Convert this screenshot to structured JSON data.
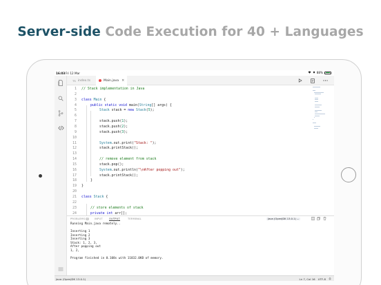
{
  "headline": {
    "strong": "Server-side",
    "soft": "Code Execution for 40 + Languages"
  },
  "status_bar": {
    "time": "16:03",
    "date": "Fri 12 Mar",
    "battery": "88%",
    "battery_level": 0.88
  },
  "tabs": [
    {
      "label": "index.ts"
    },
    {
      "label": "Main.java",
      "active": true
    }
  ],
  "code_lines": [
    {
      "n": "1",
      "indent": 0,
      "parts": [
        [
          "cmt",
          "// Stack implementation in Java"
        ]
      ]
    },
    {
      "n": "2",
      "indent": 0,
      "parts": []
    },
    {
      "n": "3",
      "indent": 0,
      "parts": [
        [
          "kw",
          "class "
        ],
        [
          "ty",
          "Main"
        ],
        [
          "plain",
          " {"
        ]
      ]
    },
    {
      "n": "4",
      "indent": 1,
      "parts": [
        [
          "kw",
          "public static void "
        ],
        [
          "plain",
          "main("
        ],
        [
          "ty",
          "String"
        ],
        [
          "plain",
          "[] args) {"
        ]
      ]
    },
    {
      "n": "5",
      "indent": 2,
      "parts": [
        [
          "ty",
          "Stack"
        ],
        [
          "plain",
          " stack = "
        ],
        [
          "kw",
          "new "
        ],
        [
          "ty",
          "Stack"
        ],
        [
          "plain",
          "("
        ],
        [
          "num",
          "5"
        ],
        [
          "plain",
          ");"
        ]
      ]
    },
    {
      "n": "6",
      "indent": 0,
      "parts": []
    },
    {
      "n": "7",
      "indent": 2,
      "parts": [
        [
          "plain",
          "stack.push("
        ],
        [
          "num",
          "1"
        ],
        [
          "plain",
          ");"
        ]
      ]
    },
    {
      "n": "8",
      "indent": 2,
      "parts": [
        [
          "plain",
          "stack.push("
        ],
        [
          "num",
          "2"
        ],
        [
          "plain",
          ");"
        ]
      ]
    },
    {
      "n": "9",
      "indent": 2,
      "parts": [
        [
          "plain",
          "stack.push("
        ],
        [
          "num",
          "3"
        ],
        [
          "plain",
          ");"
        ]
      ]
    },
    {
      "n": "10",
      "indent": 0,
      "parts": []
    },
    {
      "n": "11",
      "indent": 2,
      "parts": [
        [
          "ty",
          "System"
        ],
        [
          "plain",
          ".out.print("
        ],
        [
          "str",
          "\"Stack: \""
        ],
        [
          "plain",
          ");"
        ]
      ]
    },
    {
      "n": "12",
      "indent": 2,
      "parts": [
        [
          "plain",
          "stack.printStack();"
        ]
      ]
    },
    {
      "n": "13",
      "indent": 0,
      "parts": []
    },
    {
      "n": "14",
      "indent": 2,
      "parts": [
        [
          "cmt",
          "// remove element from stack"
        ]
      ]
    },
    {
      "n": "15",
      "indent": 2,
      "parts": [
        [
          "plain",
          "stack.pop();"
        ]
      ]
    },
    {
      "n": "16",
      "indent": 2,
      "parts": [
        [
          "ty",
          "System"
        ],
        [
          "plain",
          ".out.println("
        ],
        [
          "str",
          "\"\\nAfter popping out\""
        ],
        [
          "plain",
          ");"
        ]
      ]
    },
    {
      "n": "17",
      "indent": 2,
      "parts": [
        [
          "plain",
          "stack.printStack();"
        ]
      ]
    },
    {
      "n": "18",
      "indent": 1,
      "parts": [
        [
          "plain",
          "}"
        ]
      ]
    },
    {
      "n": "19",
      "indent": 0,
      "parts": [
        [
          "plain",
          "}"
        ]
      ]
    },
    {
      "n": "20",
      "indent": 0,
      "parts": []
    },
    {
      "n": "21",
      "indent": 0,
      "parts": [
        [
          "kw",
          "class "
        ],
        [
          "ty",
          "Stack"
        ],
        [
          "plain",
          " {"
        ]
      ]
    },
    {
      "n": "22",
      "indent": 0,
      "parts": []
    },
    {
      "n": "23",
      "indent": 1,
      "parts": [
        [
          "cmt",
          "// store elements of stack"
        ]
      ]
    },
    {
      "n": "24",
      "indent": 1,
      "parts": [
        [
          "kw",
          "private int "
        ],
        [
          "plain",
          "arr[];"
        ]
      ]
    }
  ],
  "panel": {
    "tabs": [
      {
        "label": "PROBLEMS",
        "count": "0"
      },
      {
        "label": "INPUT"
      },
      {
        "label": "OUTPUT",
        "active": true
      },
      {
        "label": "TERMINAL"
      }
    ],
    "language_select": "Java (OpenJDK 13.0.1)",
    "output_lines": [
      "Running Main.java remotely..",
      "",
      "Inserting 1",
      "Inserting 2",
      "Inserting 3",
      "Stack: 1, 2, 3,",
      "After popping out",
      "1, 2,",
      "",
      "Program finished in 0.108s with 11832.0KB of memory."
    ]
  },
  "bottom_bar": {
    "language": "Java (OpenJDK 13.0.1)",
    "cursor": "Ln 7, Col 16",
    "encoding": "UTF-8"
  },
  "icons": [
    "files-icon",
    "search-icon",
    "source-control-icon",
    "code-icon",
    "menu-icon",
    "run-icon",
    "preview-icon",
    "more-icon",
    "wifi-icon",
    "bell-icon"
  ]
}
